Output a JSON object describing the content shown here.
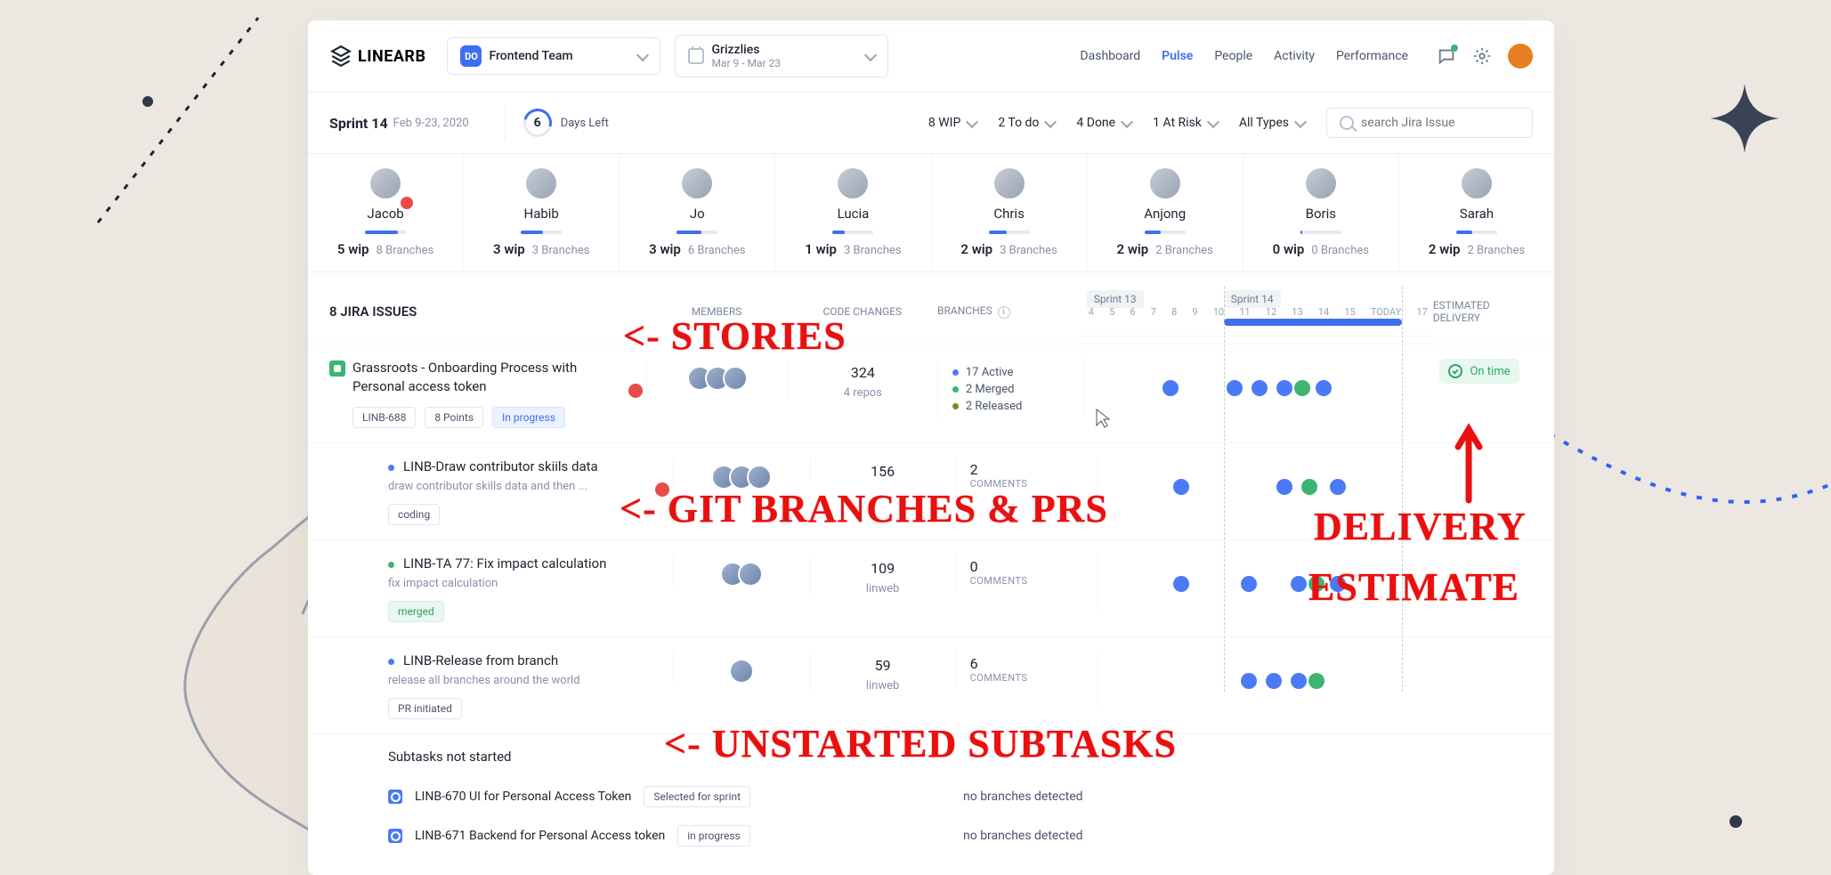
{
  "logo": "LINEARB",
  "team_selector": {
    "badge": "DO",
    "label": "Frontend Team"
  },
  "project_selector": {
    "name": "Grizzlies",
    "range": "Mar 9 - Mar 23"
  },
  "nav": {
    "dashboard": "Dashboard",
    "pulse": "Pulse",
    "people": "People",
    "activity": "Activity",
    "performance": "Performance"
  },
  "sprint": {
    "name": "Sprint 14",
    "dates": "Feb 9-23, 2020",
    "days_left_num": "6",
    "days_left_label": "Days Left"
  },
  "filters": {
    "wip": "8 WIP",
    "todo": "2 To do",
    "done": "4 Done",
    "risk": "1 At Risk",
    "types": "All Types"
  },
  "search_placeholder": "search Jira Issue",
  "members": [
    {
      "name": "Jacob",
      "wip": "5 wip",
      "branches": "8 Branches",
      "fill": 80,
      "alert": true
    },
    {
      "name": "Habib",
      "wip": "3 wip",
      "branches": "3 Branches",
      "fill": 55
    },
    {
      "name": "Jo",
      "wip": "3 wip",
      "branches": "6 Branches",
      "fill": 60
    },
    {
      "name": "Lucia",
      "wip": "1 wip",
      "branches": "3 Branches",
      "fill": 30
    },
    {
      "name": "Chris",
      "wip": "2 wip",
      "branches": "3 Branches",
      "fill": 45
    },
    {
      "name": "Anjong",
      "wip": "2 wip",
      "branches": "2 Branches",
      "fill": 40
    },
    {
      "name": "Boris",
      "wip": "0 wip",
      "branches": "0 Branches",
      "fill": 5
    },
    {
      "name": "Sarah",
      "wip": "2 wip",
      "branches": "2 Branches",
      "fill": 40
    }
  ],
  "columns": {
    "issues": "8 JIRA ISSUES",
    "members": "MEMBERS",
    "code": "CODE CHANGES",
    "branches": "BRANCHES",
    "delivery_l1": "ESTIMATED",
    "delivery_l2": "DELIVERY"
  },
  "timeline": {
    "sprint_prev": "Sprint 13",
    "sprint_cur": "Sprint 14",
    "ticks": [
      "4",
      "5",
      "6",
      "7",
      "8",
      "9",
      "10",
      "11",
      "12",
      "13",
      "14",
      "15",
      "TODAY",
      "17"
    ]
  },
  "issues": [
    {
      "type": "story",
      "title": "Grassroots - Onboarding Process with Personal access token",
      "tags": [
        "LINB-688",
        "8 Points"
      ],
      "status_tag": "In progress",
      "alert": true,
      "code": "324",
      "code_sub": "4 repos",
      "branches": [
        {
          "dot": "blue",
          "text": "17 Active"
        },
        {
          "dot": "green",
          "text": "2 Merged"
        },
        {
          "dot": "olive",
          "text": "2 Released"
        }
      ],
      "delivery": "On time",
      "dots": [
        {
          "p": 22,
          "c": "b"
        },
        {
          "p": 40,
          "c": "b"
        },
        {
          "p": 47,
          "c": "b"
        },
        {
          "p": 54,
          "c": "b"
        },
        {
          "p": 59,
          "c": "g"
        },
        {
          "p": 65,
          "c": "b"
        }
      ]
    },
    {
      "type": "task",
      "bullet": "blue",
      "title": "LINB-Draw contributor skiils data",
      "subtitle": "draw contributor skills data and then ...",
      "tags": [],
      "status_tag": "coding",
      "alert": true,
      "code": "156",
      "code_sub": "",
      "comments_n": "2",
      "comments_l": "COMMENTS",
      "dots": [
        {
          "p": 21,
          "c": "b"
        },
        {
          "p": 50,
          "c": "b"
        },
        {
          "p": 57,
          "c": "g"
        },
        {
          "p": 65,
          "c": "b"
        }
      ]
    },
    {
      "type": "task",
      "bullet": "green",
      "title": "LINB-TA 77: Fix impact calculation",
      "subtitle": "fix impact calculation",
      "tags": [],
      "status_tag": "merged",
      "status_green": true,
      "code": "109",
      "code_sub": "linweb",
      "comments_n": "0",
      "comments_l": "COMMENTS",
      "dots": [
        {
          "p": 21,
          "c": "b"
        },
        {
          "p": 40,
          "c": "b"
        },
        {
          "p": 54,
          "c": "b"
        },
        {
          "p": 59,
          "c": "g"
        },
        {
          "p": 65,
          "c": "b"
        }
      ]
    },
    {
      "type": "task",
      "bullet": "blue",
      "title": "LINB-Release from branch",
      "subtitle": "release all branches around the world",
      "tags": [],
      "status_tag": "PR initiated",
      "code": "59",
      "code_sub": "linweb",
      "comments_n": "6",
      "comments_l": "COMMENTS",
      "dots": [
        {
          "p": 40,
          "c": "b"
        },
        {
          "p": 47,
          "c": "b"
        },
        {
          "p": 54,
          "c": "b"
        },
        {
          "p": 59,
          "c": "g"
        }
      ]
    }
  ],
  "subtasks": {
    "heading": "Subtasks not started",
    "rows": [
      {
        "title": "LINB-670 UI for Personal Access Token",
        "tag": "Selected for sprint",
        "msg": "no branches detected"
      },
      {
        "title": "LINB-671 Backend for Personal Access token",
        "tag": "in progress",
        "msg": "no branches detected"
      }
    ]
  },
  "annotations": {
    "stories": "<- Stories",
    "branches": "<- Git Branches & PRs",
    "delivery1": "Delivery",
    "delivery2": "Estimate",
    "subtasks": "<- Unstarted Subtasks"
  }
}
